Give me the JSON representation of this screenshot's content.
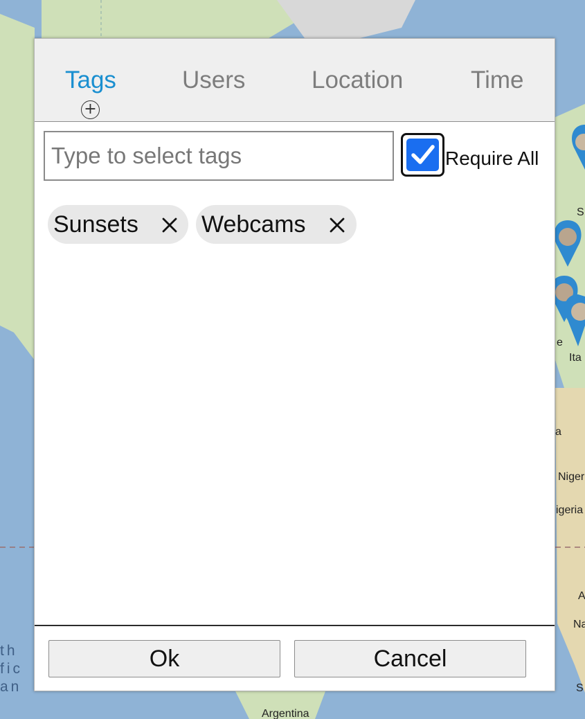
{
  "map": {
    "labels": [
      "Argentina",
      "Niger",
      "igeria",
      "Ita",
      "Na",
      "S",
      "A",
      "S",
      "a",
      "e"
    ],
    "ocean_label_lines": [
      "th",
      "fic",
      "an"
    ],
    "pin_icon": "photo-pin-icon"
  },
  "dialog": {
    "tabs": [
      {
        "label": "Tags",
        "active": true
      },
      {
        "label": "Users",
        "active": false
      },
      {
        "label": "Location",
        "active": false
      },
      {
        "label": "Time",
        "active": false
      }
    ],
    "add_icon": "plus-circle-icon",
    "search": {
      "placeholder": "Type to select tags",
      "value": ""
    },
    "require_all": {
      "label": "Require All",
      "checked": true
    },
    "selected_tags": [
      {
        "label": "Sunsets",
        "remove_icon": "close-icon"
      },
      {
        "label": "Webcams",
        "remove_icon": "close-icon"
      }
    ],
    "buttons": {
      "ok": "Ok",
      "cancel": "Cancel"
    }
  },
  "colors": {
    "active_tab": "#1a8fd0",
    "inactive_tab": "#7d7d7d",
    "checkbox_fill": "#1a6ef0",
    "chip_bg": "#e8e8e8",
    "map_water": "#8fb3d6",
    "map_land": "#cfe0b8"
  }
}
